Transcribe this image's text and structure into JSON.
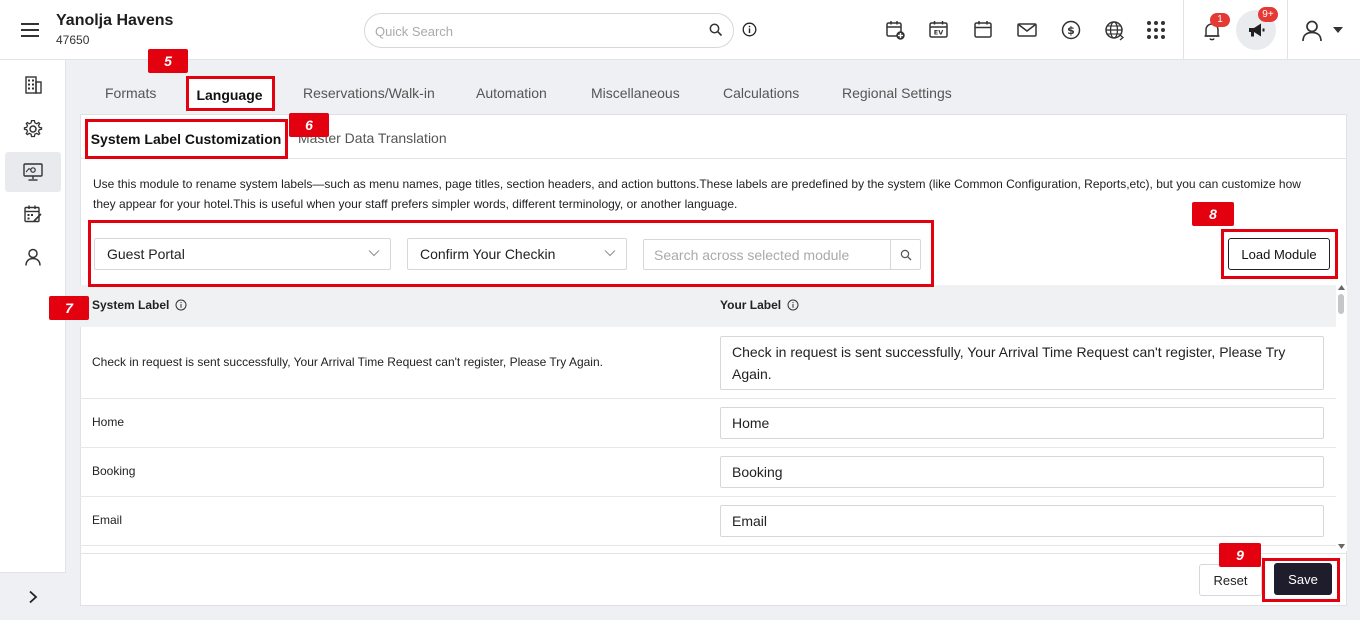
{
  "header": {
    "hotel_name": "Yanolja Havens",
    "hotel_id": "47650",
    "search_placeholder": "Quick Search",
    "notification_count": "1",
    "announcement_count": "9+"
  },
  "tabs": [
    "Formats",
    "Language",
    "Reservations/Walk-in",
    "Automation",
    "Miscellaneous",
    "Calculations",
    "Regional Settings"
  ],
  "subtabs": [
    "System Label Customization",
    "Master Data Translation"
  ],
  "description": "Use this module to rename system labels—such as menu names, page titles, section headers, and action buttons.These labels are predefined by the system (like Common Configuration, Reports,etc), but you can customize how they appear for your hotel.This is useful when your staff prefers simpler words, different terminology, or another language.",
  "filters": {
    "module": "Guest Portal",
    "page": "Confirm Your Checkin",
    "search_placeholder": "Search across selected module",
    "load_button": "Load Module"
  },
  "table": {
    "headers": {
      "system_label": "System Label",
      "your_label": "Your Label"
    },
    "rows": [
      {
        "system": "Check in request is sent successfully, Your Arrival Time Request can't register, Please Try Again.",
        "yours": "Check in request is sent successfully, Your Arrival Time Request can't register, Please Try Again."
      },
      {
        "system": "Home",
        "yours": "Home"
      },
      {
        "system": "Booking",
        "yours": "Booking"
      },
      {
        "system": "Email",
        "yours": "Email"
      }
    ]
  },
  "actions": {
    "reset": "Reset",
    "save": "Save"
  },
  "callouts": [
    "5",
    "6",
    "7",
    "8",
    "9"
  ],
  "colors": {
    "callout": "#e3000f",
    "save_button": "#1f1d2b",
    "badge": "#e53935"
  },
  "icons": [
    "menu-icon",
    "search-icon",
    "info-icon",
    "calendar-add-icon",
    "calendar-ev-icon",
    "calendar-icon",
    "mail-icon",
    "dollar-icon",
    "globe-icon",
    "apps-grid-icon",
    "bell-icon",
    "megaphone-icon",
    "user-icon",
    "building-icon",
    "gear-icon",
    "monitor-icon",
    "calendar-edit-icon",
    "person-icon",
    "chevron-right-icon"
  ]
}
